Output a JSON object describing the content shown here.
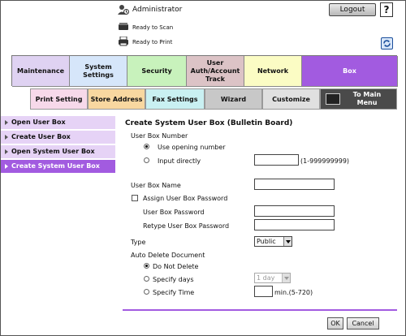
{
  "header": {
    "user_label": "Administrator",
    "logout_label": "Logout",
    "help_label": "?",
    "status": [
      {
        "icon": "scanner-icon",
        "label": "Ready to Scan"
      },
      {
        "icon": "printer-icon",
        "label": "Ready to Print"
      }
    ]
  },
  "tabs": {
    "maintenance": "Maintenance",
    "system_settings": "System Settings",
    "security": "Security",
    "user_auth": "User Auth/Account Track",
    "network": "Network",
    "box": "Box"
  },
  "subtabs": {
    "print_setting": "Print Setting",
    "store_address": "Store Address",
    "fax_settings": "Fax Settings",
    "wizard": "Wizard",
    "customize": "Customize",
    "to_main_menu": "To Main Menu"
  },
  "nav": {
    "items": [
      {
        "label": "Open User Box"
      },
      {
        "label": "Create User Box"
      },
      {
        "label": "Open System User Box"
      },
      {
        "label": "Create System User Box"
      }
    ]
  },
  "form": {
    "title": "Create System User Box (Bulletin Board)",
    "user_box_number_label": "User Box Number",
    "use_opening_number_label": "Use opening number",
    "input_directly_label": "Input directly",
    "input_directly_value": "",
    "input_directly_range": "(1-999999999)",
    "user_box_name_label": "User Box Name",
    "user_box_name_value": "",
    "assign_password_label": "Assign User Box Password",
    "user_box_password_label": "User Box Password",
    "user_box_password_value": "",
    "retype_password_label": "Retype User Box Password",
    "retype_password_value": "",
    "type_label": "Type",
    "type_value": "Public",
    "auto_delete_label": "Auto Delete Document",
    "do_not_delete_label": "Do Not Delete",
    "specify_days_label": "Specify days",
    "specify_days_value": "1 day",
    "specify_time_label": "Specify Time",
    "specify_time_value": "",
    "specify_time_range": "min.(5-720)"
  },
  "buttons": {
    "ok": "OK",
    "cancel": "Cancel"
  },
  "colors": {
    "box_accent": "#a25be0",
    "nav_bg": "#e6d3f6"
  }
}
